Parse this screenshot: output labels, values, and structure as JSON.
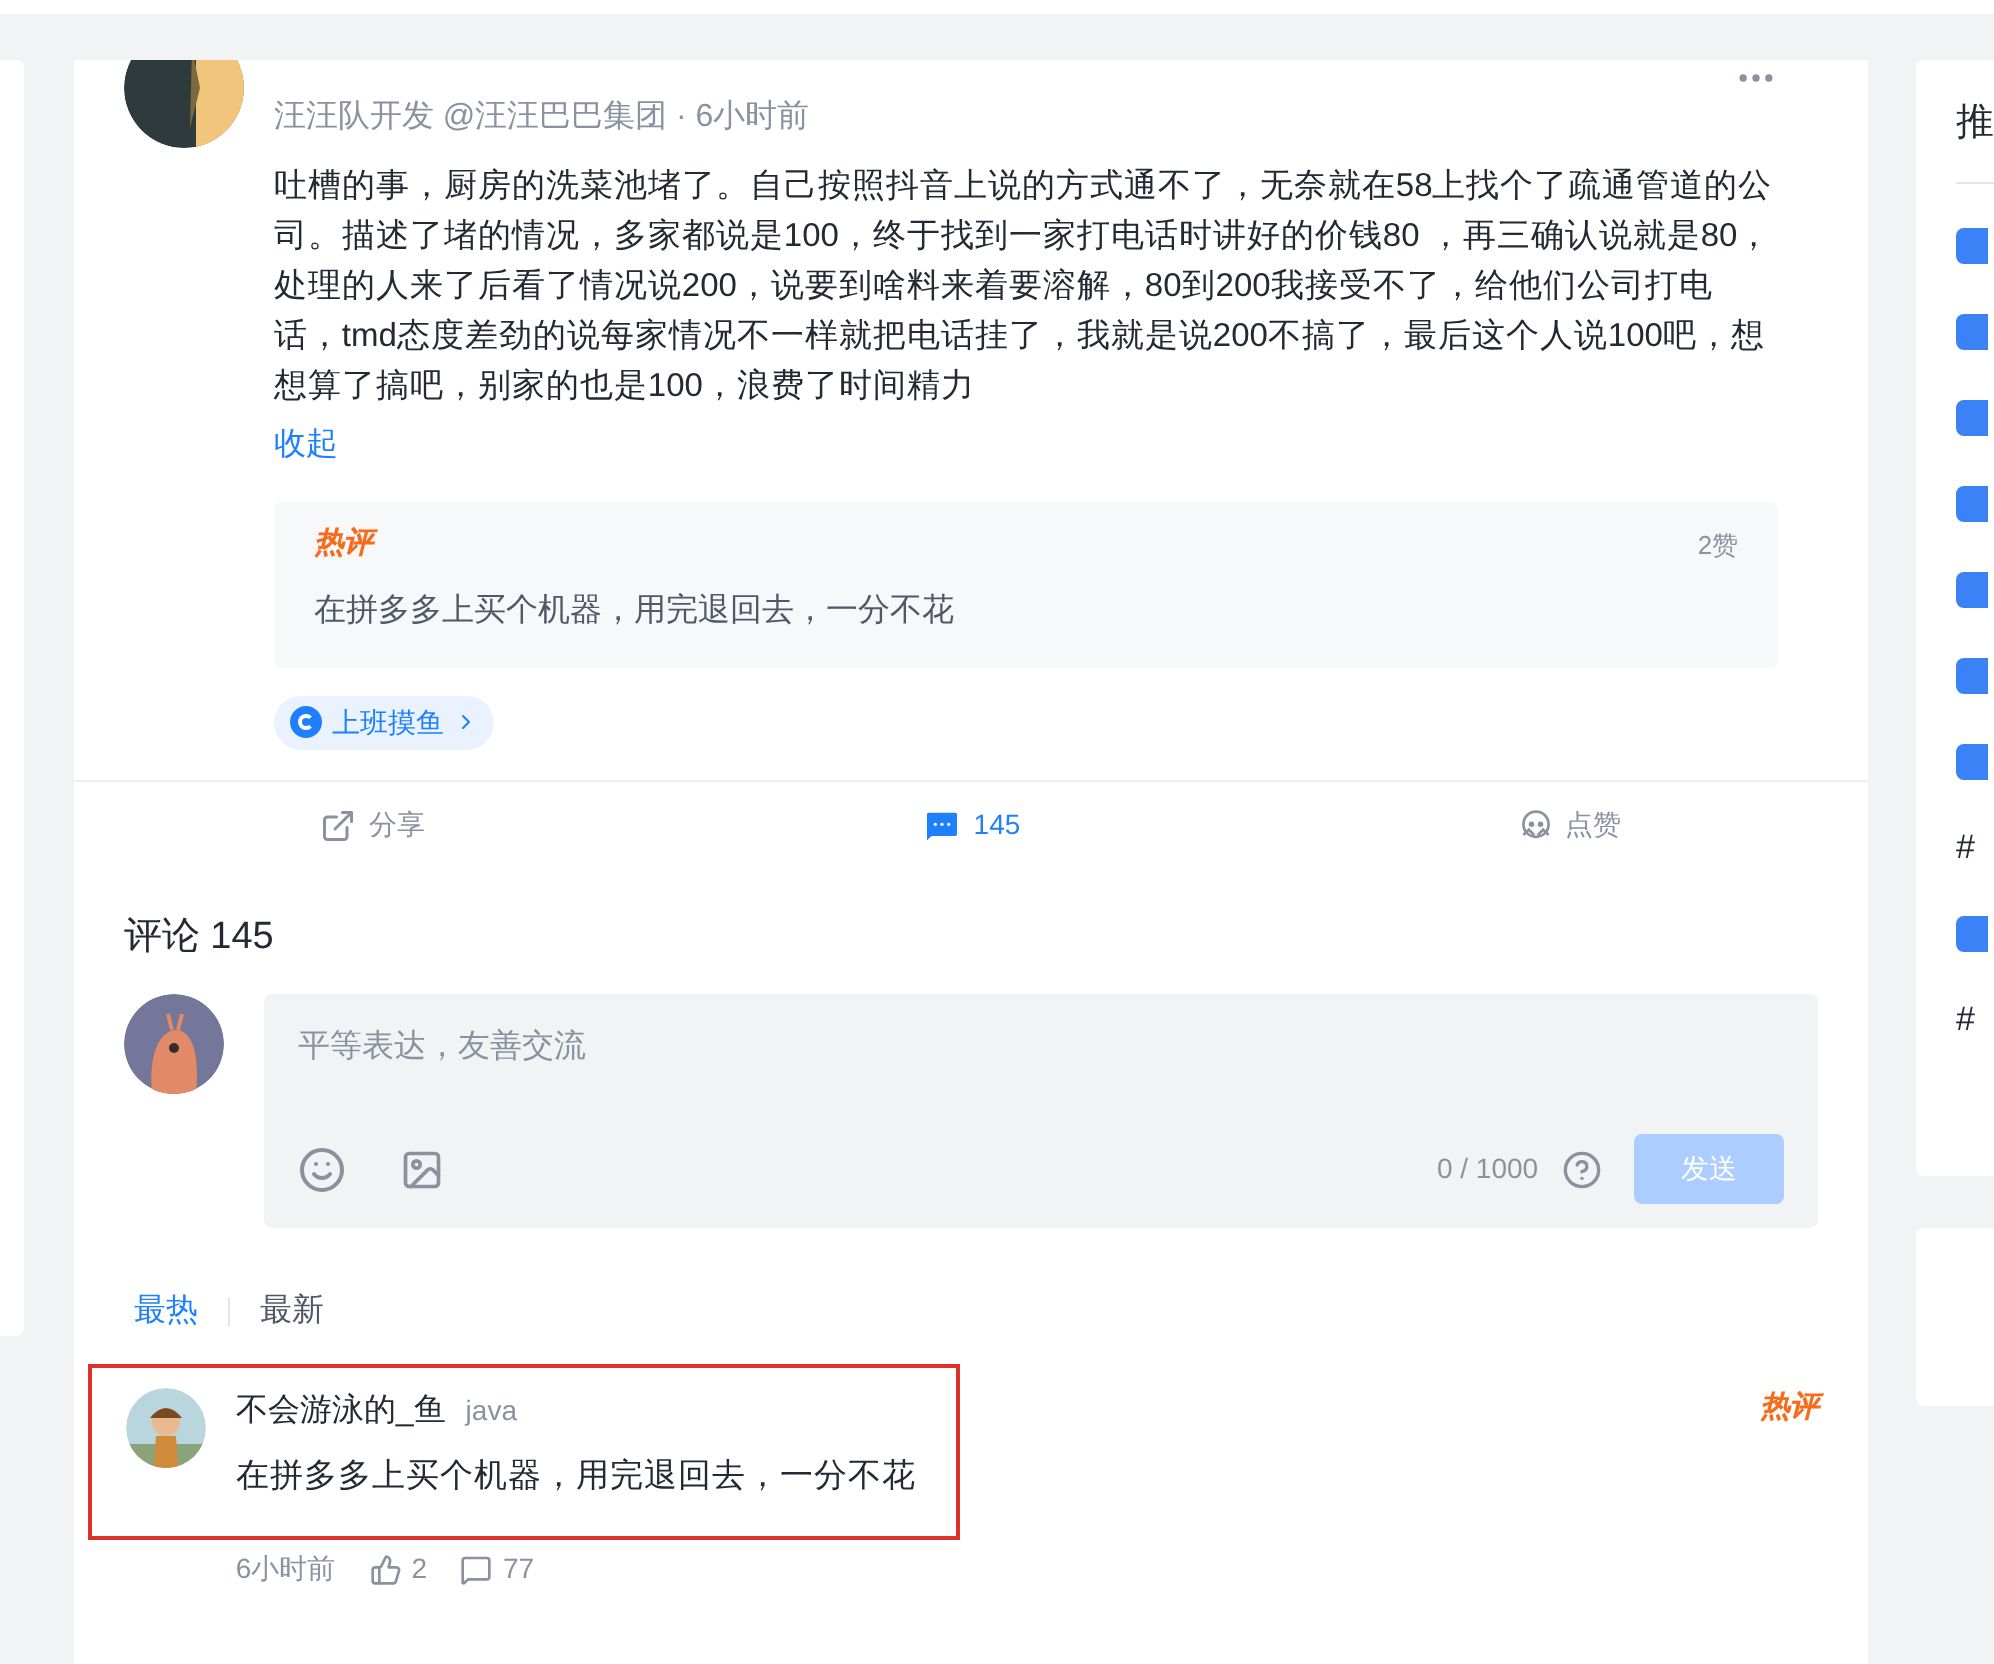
{
  "post": {
    "author_meta": "汪汪队开发 @汪汪巴巴集团 · 6小时前",
    "body": "吐槽的事，厨房的洗菜池堵了。自己按照抖音上说的方式通不了，无奈就在58上找个了疏通管道的公司。描述了堵的情况，多家都说是100，终于找到一家打电话时讲好的价钱80 ，再三确认说就是80，处理的人来了后看了情况说200，说要到啥料来着要溶解，80到200我接受不了，给他们公司打电话，tmd态度差劲的说每家情况不一样就把电话挂了，我就是说200不搞了，最后这个人说100吧，想想算了搞吧，别家的也是100，浪费了时间精力",
    "collapse_link": "收起",
    "hot_comment": {
      "badge": "热评",
      "likes": "2赞",
      "text": "在拼多多上买个机器，用完退回去，一分不花"
    },
    "topic": "上班摸鱼",
    "actions": [
      {
        "kind": "share",
        "label": "分享",
        "selected": false
      },
      {
        "kind": "comment",
        "label": "145",
        "selected": true
      },
      {
        "kind": "like",
        "label": "点赞",
        "selected": false
      }
    ]
  },
  "comments": {
    "title": "评论 145",
    "input": {
      "placeholder": "平等表达，友善交流",
      "counter": "0 / 1000",
      "send": "发送",
      "disabled": true
    },
    "sort_tabs": [
      {
        "label": "最热",
        "selected": true
      },
      {
        "label": "最新",
        "selected": false
      }
    ],
    "items": [
      {
        "user": "不会游泳的_鱼",
        "tag": "java",
        "text": "在拼多多上买个机器，用完退回去，一分不花",
        "badge": "热评",
        "time": "6小时前",
        "likes": "2",
        "replies": "77",
        "highlighted": true
      }
    ]
  },
  "sidebar": {
    "title": "推",
    "items": [
      {
        "kind": "badge"
      },
      {
        "kind": "badge"
      },
      {
        "kind": "badge"
      },
      {
        "kind": "badge"
      },
      {
        "kind": "badge"
      },
      {
        "kind": "badge"
      },
      {
        "kind": "badge"
      },
      {
        "kind": "hashtag",
        "text": "#"
      },
      {
        "kind": "badge"
      },
      {
        "kind": "hashtag",
        "text": "#"
      }
    ]
  }
}
